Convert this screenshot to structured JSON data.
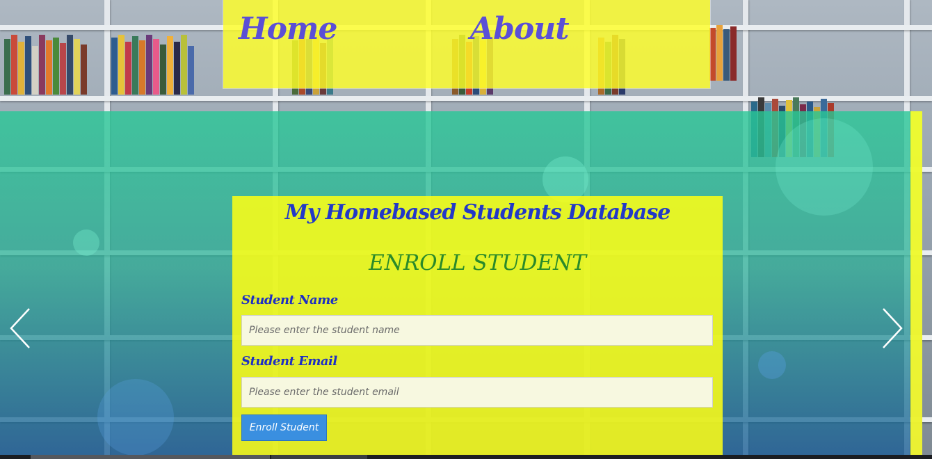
{
  "nav": {
    "home_label": "Home",
    "about_label": "About"
  },
  "form": {
    "site_title": "My Homebased Students Database",
    "heading": "ENROLL STUDENT",
    "name_label": "Student Name",
    "name_placeholder": "Please enter the student name",
    "email_label": "Student Email",
    "email_placeholder": "Please enter the student email",
    "submit_label": "Enroll Student"
  },
  "carousel": {
    "prev_icon": "chevron-left-icon",
    "next_icon": "chevron-right-icon"
  },
  "colors": {
    "nav_bg": "#ffff28",
    "nav_text": "#5b4fd6",
    "overlay_top": "#28c896",
    "overlay_bottom": "#195a96",
    "card_bg": "#ffff14",
    "title_text": "#2238c8",
    "heading_text": "#2a8a2a",
    "button_bg": "#3a8fe0"
  }
}
